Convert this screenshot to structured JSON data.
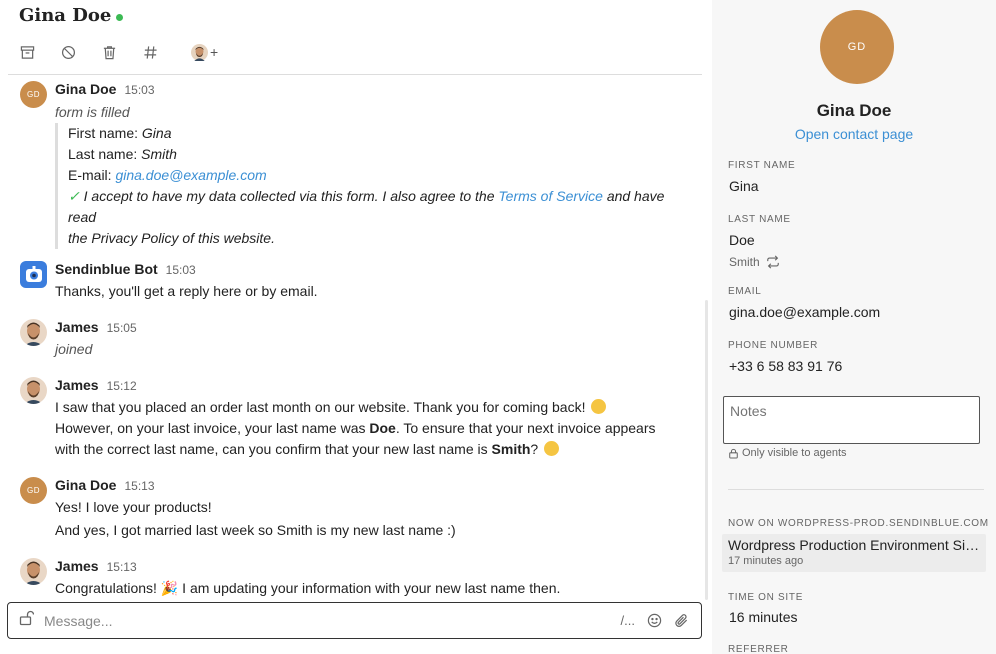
{
  "chat": {
    "title": "Gina Doe",
    "composer_placeholder": "Message...",
    "composer_shortcut": "/...",
    "messages": [
      {
        "author": "Gina Doe",
        "time": "15:03",
        "avatar": "GD",
        "text": "form is filled",
        "form": {
          "first_name_label": "First name:",
          "first_name": "Gina",
          "last_name_label": "Last name:",
          "last_name": "Smith",
          "email_label": "E-mail:",
          "email": "gina.doe@example.com",
          "consent_a": "I accept to have my data collected via this form. I also agree to the",
          "consent_link": "Terms of Service",
          "consent_b": "and have read",
          "consent_c": "the Privacy Policy of this website."
        }
      },
      {
        "author": "Sendinblue Bot",
        "time": "15:03",
        "text": "Thanks, you'll get a reply here or by email."
      },
      {
        "author": "James",
        "time": "15:05",
        "text": "joined"
      },
      {
        "author": "James",
        "time": "15:12",
        "line1": "I saw that you placed an order last month on our website. Thank you for coming back!",
        "line2a": "However, on your last invoice, your last name was",
        "line2b": "Doe",
        "line2c": ". To ensure that your next invoice appears",
        "line3a": "with the correct last name, can you confirm that your new last name is",
        "line3b": "Smith",
        "line3c": "?"
      },
      {
        "author": "Gina Doe",
        "time": "15:13",
        "avatar": "GD",
        "line1": "Yes! I love your products!",
        "line2": "And yes, I got married last week so Smith is my new last name :)"
      },
      {
        "author": "James",
        "time": "15:13",
        "line1a": "Congratulations!",
        "line1b": "I am updating your information with your new last name then."
      }
    ]
  },
  "contact": {
    "avatar": "GD",
    "name": "Gina Doe",
    "open_link": "Open contact page",
    "first_name_label": "FIRST NAME",
    "first_name": "Gina",
    "last_name_label": "LAST NAME",
    "last_name": "Doe",
    "last_name_suggestion": "Smith",
    "email_label": "EMAIL",
    "email": "gina.doe@example.com",
    "phone_label": "PHONE NUMBER",
    "phone": "+33 6 58 83 91 76",
    "notes_placeholder": "Notes",
    "notes_hint": "Only visible to agents",
    "now_on_label": "NOW ON WORDPRESS-PROD.SENDINBLUE.COM",
    "now_on_page": "Wordpress Production Environment Sit...",
    "now_on_ago": "17 minutes ago",
    "time_on_site_label": "TIME ON SITE",
    "time_on_site": "16 minutes",
    "referrer_label": "REFERRER"
  },
  "colors": {
    "accent": "#3b8fd4",
    "avatar": "#c98d4c",
    "online": "#3cba54"
  }
}
